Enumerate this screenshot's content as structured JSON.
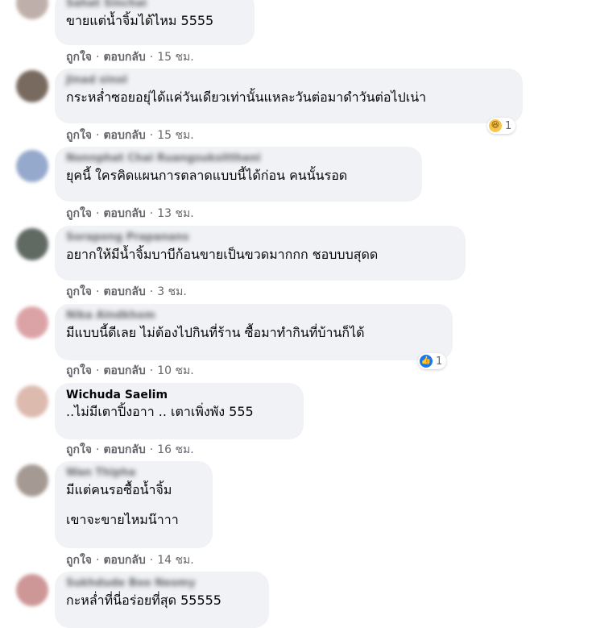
{
  "labels": {
    "like": "ถูกใจ",
    "reply": "ตอบกลับ",
    "separator": "·"
  },
  "comments": [
    {
      "name": "Sahat Sinchai",
      "lines": [
        "ขายแต่น้ำจิ้มได้ไหม 5555"
      ],
      "time": "15 ชม."
    },
    {
      "name": "Jinad sinol",
      "lines": [
        "กระหล่ำซอยอยุ่ได้แค่วันเดียวเท่านั้นแหละวันต่อมาดำวันต่อไปเน่า"
      ],
      "time": "15 ชม.",
      "reaction": {
        "icon": "haha-emoji-icon",
        "count": "1"
      }
    },
    {
      "name": "Nonnphat Chai Ruangsuksitthani",
      "lines": [
        "ยุคนี้ ใครคิดแผนการตลาดแบบนี้ได้ก่อน คนนั้นรอด"
      ],
      "time": "13 ชม."
    },
    {
      "name": "Sorapong Prapanans",
      "lines": [
        "อยากให้มีน้ำจิ้มบาบีก้อนขายเป็นขวดมากกก ชอบบบสุดด"
      ],
      "time": "3 ชม."
    },
    {
      "name": "Nika Aindkhom",
      "lines": [
        "มีแบบนี้ดีเลย ไม่ต้องไปกินที่ร้าน ซื้อมาทำกินที่บ้านก็ได้"
      ],
      "time": "10 ชม.",
      "reaction": {
        "icon": "like-thumb-icon",
        "count": "1"
      }
    },
    {
      "name": "Wichuda Saelim",
      "lines": [
        "..ไม่มีเตาปิ้งอาา .. เตาเพิ่งพัง 555"
      ],
      "time": "16 ชม."
    },
    {
      "name": "Wan Thipha",
      "lines": [
        "มีแต่คนรอซื้อน้ำจิ้ม",
        "เขาจะขายไหมน๊าาา"
      ],
      "time": "14 ชม."
    },
    {
      "name": "Sukhdude Boo Neomy",
      "lines": [
        "กะหล่ำที่นี่อร่อยที่สุด 55555"
      ],
      "time": ""
    }
  ],
  "colors": {
    "bubble": "#f0f2f5",
    "meta": "#65676b",
    "text": "#050505",
    "like": "#1877f2",
    "haha": "#f7c74d"
  }
}
